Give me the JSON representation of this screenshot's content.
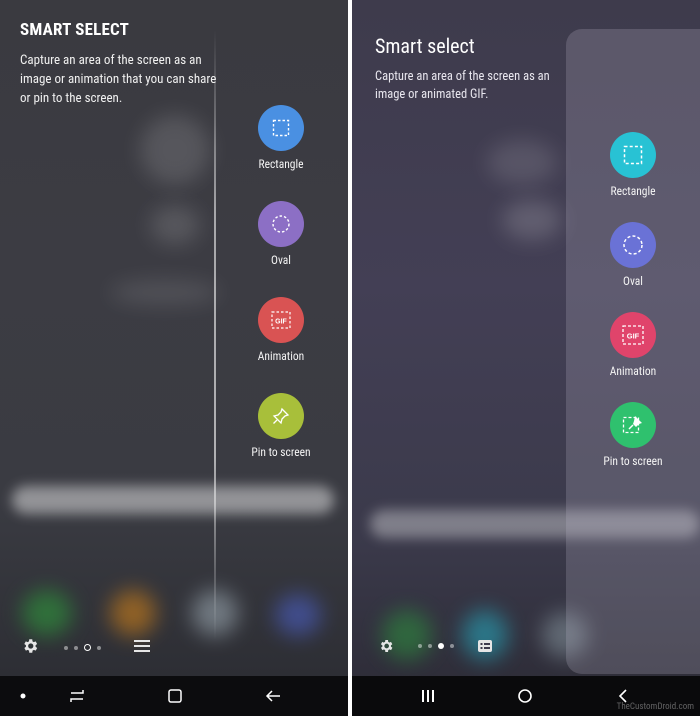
{
  "left_screen": {
    "title": "SMART SELECT",
    "description": "Capture an area of the screen as an image or animation that you can share or pin to the screen.",
    "tools": [
      {
        "label": "Rectangle",
        "icon": "dashed-rectangle-icon",
        "color": "#4a90e2"
      },
      {
        "label": "Oval",
        "icon": "dashed-circle-icon",
        "color": "#8c6fc5"
      },
      {
        "label": "Animation",
        "icon": "gif-icon",
        "color": "#d95353"
      },
      {
        "label": "Pin to screen",
        "icon": "pin-icon",
        "color": "#a8bf3a"
      }
    ],
    "home_page_indicator": {
      "pages": 4,
      "current_index": 2
    },
    "nav": [
      "dot-button",
      "recents-button",
      "home-button",
      "back-button"
    ]
  },
  "right_screen": {
    "title": "Smart select",
    "description": "Capture an area of the screen as an image or animated GIF.",
    "tools": [
      {
        "label": "Rectangle",
        "icon": "dashed-rectangle-icon",
        "color": "#28c2d4"
      },
      {
        "label": "Oval",
        "icon": "dashed-circle-icon",
        "color": "#6a72d6"
      },
      {
        "label": "Animation",
        "icon": "gif-icon",
        "color": "#e0446b"
      },
      {
        "label": "Pin to screen",
        "icon": "pin-icon",
        "color": "#2fc16e"
      }
    ],
    "home_page_indicator": {
      "pages": 4,
      "current_index": 2
    },
    "nav": [
      "recents-button",
      "home-button",
      "back-button"
    ]
  },
  "watermark": "TheCustomDroid.com"
}
